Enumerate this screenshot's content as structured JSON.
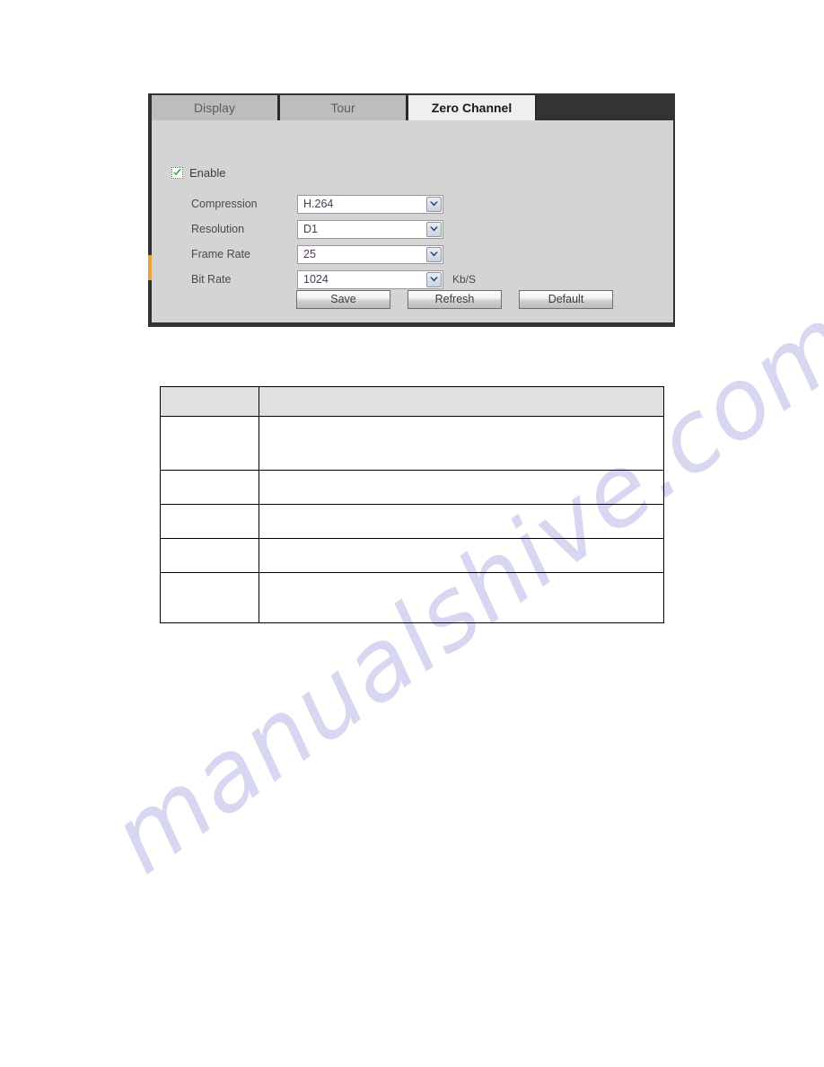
{
  "panel": {
    "tabs": [
      {
        "label": "Display",
        "name": "tab-display",
        "active": false
      },
      {
        "label": "Tour",
        "name": "tab-tour",
        "active": false
      },
      {
        "label": "Zero Channel",
        "name": "tab-zero-channel",
        "active": true
      }
    ],
    "enable": {
      "label": "Enable",
      "checked": true,
      "check_color": "#2e9e2e"
    },
    "fields": [
      {
        "label": "Compression",
        "value": "H.264",
        "unit": ""
      },
      {
        "label": "Resolution",
        "value": "D1",
        "unit": ""
      },
      {
        "label": "Frame Rate",
        "value": "25",
        "unit": ""
      },
      {
        "label": "Bit Rate",
        "value": "1024",
        "unit": "Kb/S"
      }
    ],
    "buttons": [
      {
        "label": "Save",
        "name": "save-button"
      },
      {
        "label": "Refresh",
        "name": "refresh-button"
      },
      {
        "label": "Default",
        "name": "default-button"
      }
    ]
  },
  "table": {
    "headers": [
      "",
      ""
    ],
    "rows": [
      [
        "",
        ""
      ],
      [
        "",
        ""
      ],
      [
        "",
        ""
      ],
      [
        "",
        ""
      ],
      [
        "",
        ""
      ]
    ]
  },
  "watermark": {
    "text": "manualshive.com",
    "color": "#c9c9ee"
  }
}
